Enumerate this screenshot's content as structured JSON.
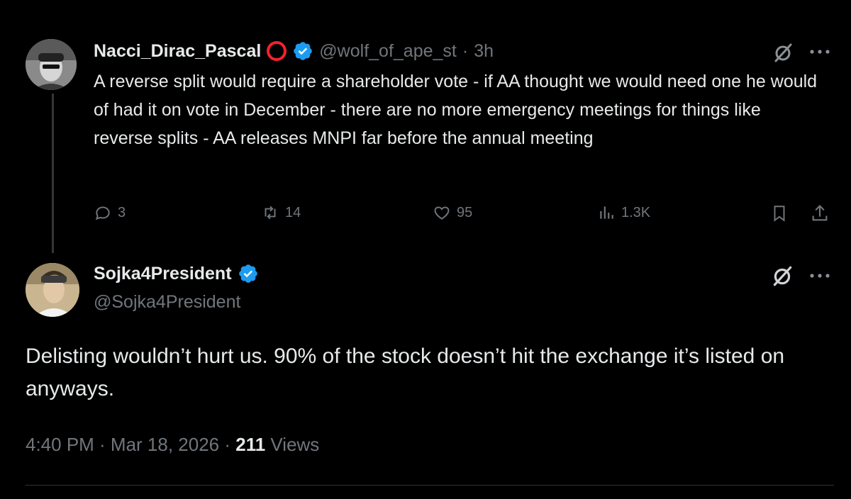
{
  "reply_tweet": {
    "display_name": "Nacci_Dirac_Pascal",
    "handle": "@wolf_of_ape_st",
    "time": "3h",
    "separator": "·",
    "text": "A reverse split would require a shareholder vote - if AA thought we would need one he would of had it on vote in December - there are no more emergency meetings for things like reverse splits - AA releases MNPI far before the annual meeting",
    "actions": {
      "replies": "3",
      "reposts": "14",
      "likes": "95",
      "views": "1.3K"
    }
  },
  "main_tweet": {
    "display_name": "Sojka4President",
    "handle": "@Sojka4President",
    "text": "Delisting wouldn’t hurt us.  90% of the stock doesn’t hit the exchange it’s listed on anyways.",
    "timestamp": "4:40 PM · Mar 18, 2026 · ",
    "views_count": "211",
    "views_label": " Views"
  },
  "colors": {
    "background": "#000000",
    "text_primary": "#e7e9ea",
    "text_secondary": "#71767b",
    "verified_blue": "#1d9bf0",
    "ring_red": "#f4212e"
  },
  "icons": {
    "more": "more-horizontal-icon",
    "grok": "grok-icon",
    "verified": "verified-badge-icon"
  }
}
